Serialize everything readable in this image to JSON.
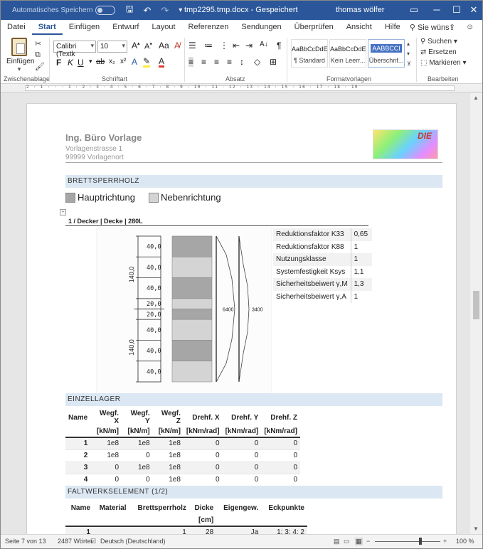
{
  "titlebar": {
    "autosave_label": "Automatisches Speichern",
    "doc_title": "tmp2295.tmp.docx  -  Gespeichert",
    "user": "thomas wölfer"
  },
  "tabs": [
    "Datei",
    "Start",
    "Einfügen",
    "Entwurf",
    "Layout",
    "Referenzen",
    "Sendungen",
    "Überprüfen",
    "Ansicht",
    "Hilfe"
  ],
  "search_label": "Sie wüns",
  "ribbon": {
    "paste_label": "Einfügen",
    "font_name": "Calibri (Textk",
    "font_size": "10",
    "styles": [
      {
        "preview": "AaBbCcDdE",
        "name": "¶ Standard"
      },
      {
        "preview": "AaBbCcDdE",
        "name": "Kein Leerr..."
      },
      {
        "preview": "AABBCCI",
        "name": "Überschrif..."
      }
    ],
    "edit": {
      "find": "Suchen",
      "replace": "Ersetzen",
      "select": "Markieren"
    },
    "groups": [
      "Zwischenablage",
      "Schriftart",
      "Absatz",
      "Formatvorlagen",
      "Bearbeiten"
    ]
  },
  "ruler_text": "2 · 1 · · · 1 · 2 · 3 · 4 · 5 · 6 · 7 · 8 · 9 · 10 · 11 · 12 · 13 · 14 · 15 · 16 · 17 · 18 · 19",
  "header": {
    "company": "Ing. Büro Vorlage",
    "street": "Vorlagenstrasse 1",
    "city": "99999 Vorlagenort",
    "logo_text": "DIE"
  },
  "sections": {
    "bsp": "BRETTSPERRHOLZ",
    "lager": "EINZELLAGER",
    "falt": "FALTWERKSELEMENT (1/2)"
  },
  "legend": {
    "main": "Hauptrichtung",
    "secondary": "Nebenrichtung",
    "main_color": "#a6a6a6",
    "secondary_color": "#d4d4d4"
  },
  "caption": "1 / Decker | Decke | 280L",
  "layup": {
    "layers": [
      40.0,
      40.0,
      40.0,
      20.0,
      20.0,
      40.0,
      40.0,
      40.0
    ],
    "directions": [
      "main",
      "sec",
      "main",
      "sec",
      "main",
      "sec",
      "main",
      "sec"
    ],
    "labels": [
      "40,0",
      "40,0",
      "40,0",
      "20,0",
      "20,0",
      "40,0",
      "40,0",
      "40,0"
    ],
    "half_labels": [
      "140,0",
      "140,0"
    ],
    "stiffness_labels": [
      "6400",
      "3400"
    ]
  },
  "properties": [
    {
      "name": "Reduktionsfaktor K33",
      "value": "0,65"
    },
    {
      "name": "Reduktionsfaktor K88",
      "value": "1"
    },
    {
      "name": "Nutzungsklasse",
      "value": "1"
    },
    {
      "name": "Systemfestigkeit Ksys",
      "value": "1,1"
    },
    {
      "name": "Sicherheitsbeiwert γ,M",
      "value": "1,3"
    },
    {
      "name": "Sicherheitsbeiwert γ,A",
      "value": "1"
    }
  ],
  "lager_table": {
    "headers": [
      "Name",
      "Wegf. X",
      "Wegf. Y",
      "Wegf. Z",
      "Drehf. X",
      "Drehf. Y",
      "Drehf. Z"
    ],
    "units": [
      "",
      "[kN/m]",
      "[kN/m]",
      "[kN/m]",
      "[kNm/rad]",
      "[kNm/rad]",
      "[kNm/rad]"
    ],
    "rows": [
      [
        "1",
        "1e8",
        "1e8",
        "1e8",
        "0",
        "0",
        "0"
      ],
      [
        "2",
        "1e8",
        "0",
        "1e8",
        "0",
        "0",
        "0"
      ],
      [
        "3",
        "0",
        "1e8",
        "1e8",
        "0",
        "0",
        "0"
      ],
      [
        "4",
        "0",
        "0",
        "1e8",
        "0",
        "0",
        "0"
      ]
    ]
  },
  "falt_table": {
    "headers": [
      "Name",
      "Material",
      "Brettsperrholz",
      "Dicke",
      "Eigengew.",
      "Eckpunkte"
    ],
    "units": [
      "",
      "",
      "",
      "[cm]",
      "",
      ""
    ],
    "rows": [
      [
        "1",
        "",
        "1",
        "28",
        "Ja",
        "1; 3; 4; 2"
      ]
    ]
  },
  "status": {
    "page": "Seite 7 von 13",
    "words": "2487 Wörter",
    "language": "Deutsch (Deutschland)",
    "zoom": "100 %"
  }
}
